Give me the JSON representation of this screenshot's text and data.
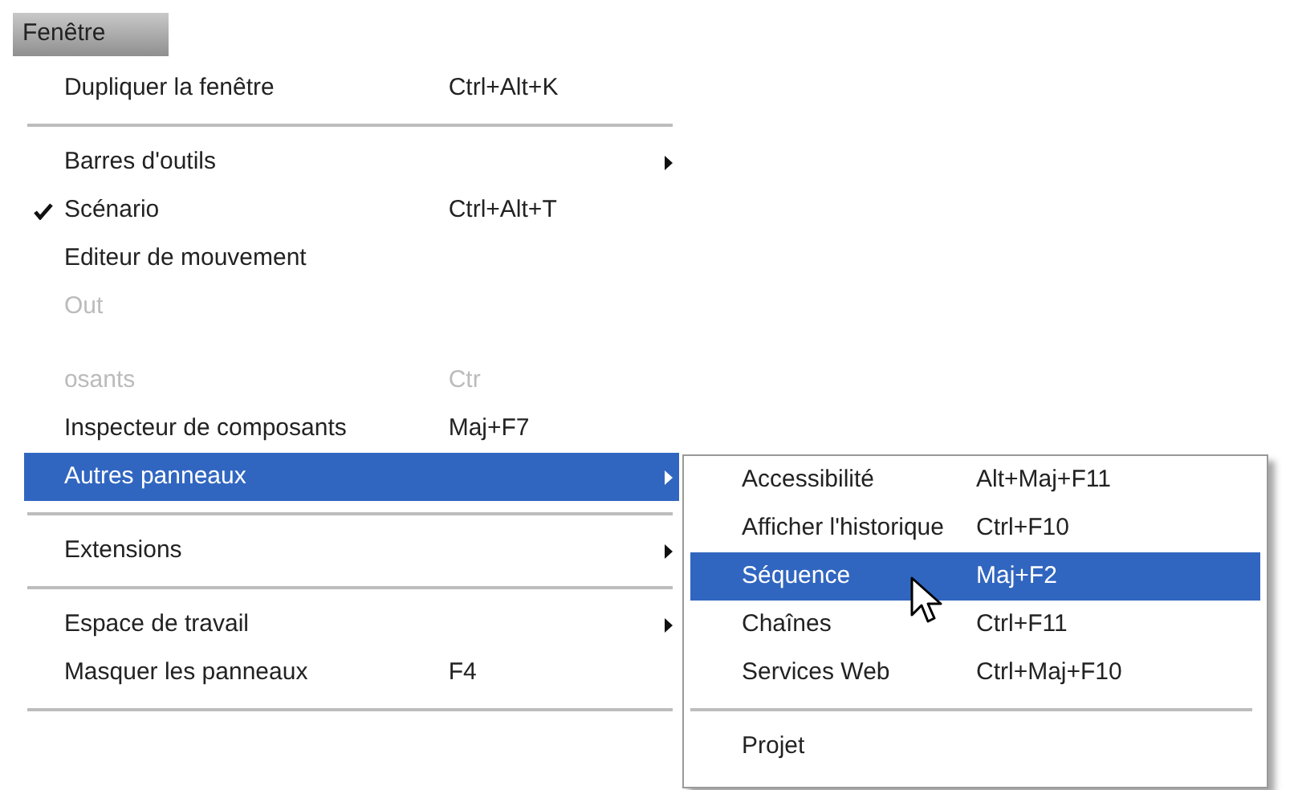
{
  "menu_title": "Fenêtre",
  "menu": [
    {
      "kind": "item",
      "label": "Dupliquer la fenêtre",
      "shortcut": "Ctrl+Alt+K",
      "checked": false,
      "submenu": false,
      "selected": false,
      "faded": false
    },
    {
      "kind": "separator"
    },
    {
      "kind": "item",
      "label": "Barres d'outils",
      "checked": false,
      "submenu": true,
      "selected": false,
      "faded": false
    },
    {
      "kind": "item",
      "label": "Scénario",
      "shortcut": "Ctrl+Alt+T",
      "checked": true,
      "submenu": false,
      "selected": false,
      "faded": false
    },
    {
      "kind": "item",
      "label": "Editeur de mouvement",
      "checked": false,
      "submenu": false,
      "selected": false,
      "faded": false
    },
    {
      "kind": "item",
      "label": "Out",
      "checked": false,
      "submenu": false,
      "selected": false,
      "faded": true
    },
    {
      "kind": "gap"
    },
    {
      "kind": "item",
      "label": "osants",
      "shortcut": "Ctr",
      "checked": false,
      "submenu": false,
      "selected": false,
      "faded": true
    },
    {
      "kind": "item",
      "label": "Inspecteur de composants",
      "shortcut": "Maj+F7",
      "checked": false,
      "submenu": false,
      "selected": false,
      "faded": false
    },
    {
      "kind": "item",
      "label": "Autres panneaux",
      "checked": false,
      "submenu": true,
      "selected": true,
      "faded": false
    },
    {
      "kind": "separator"
    },
    {
      "kind": "item",
      "label": "Extensions",
      "checked": false,
      "submenu": true,
      "selected": false,
      "faded": false
    },
    {
      "kind": "separator"
    },
    {
      "kind": "item",
      "label": "Espace de travail",
      "checked": false,
      "submenu": true,
      "selected": false,
      "faded": false
    },
    {
      "kind": "item",
      "label": "Masquer les panneaux",
      "shortcut": "F4",
      "checked": false,
      "submenu": false,
      "selected": false,
      "faded": false
    },
    {
      "kind": "separator"
    },
    {
      "kind": "blank"
    }
  ],
  "submenu": [
    {
      "kind": "item",
      "label": "Accessibilité",
      "shortcut": "Alt+Maj+F11",
      "selected": false
    },
    {
      "kind": "item",
      "label": "Afficher l'historique",
      "shortcut": "Ctrl+F10",
      "selected": false
    },
    {
      "kind": "item",
      "label": "Séquence",
      "shortcut": "Maj+F2",
      "selected": true
    },
    {
      "kind": "item",
      "label": "Chaînes",
      "shortcut": "Ctrl+F11",
      "selected": false
    },
    {
      "kind": "item",
      "label": "Services Web",
      "shortcut": "Ctrl+Maj+F10",
      "selected": false
    },
    {
      "kind": "separator"
    },
    {
      "kind": "item",
      "label": "Projet",
      "selected": false
    }
  ]
}
